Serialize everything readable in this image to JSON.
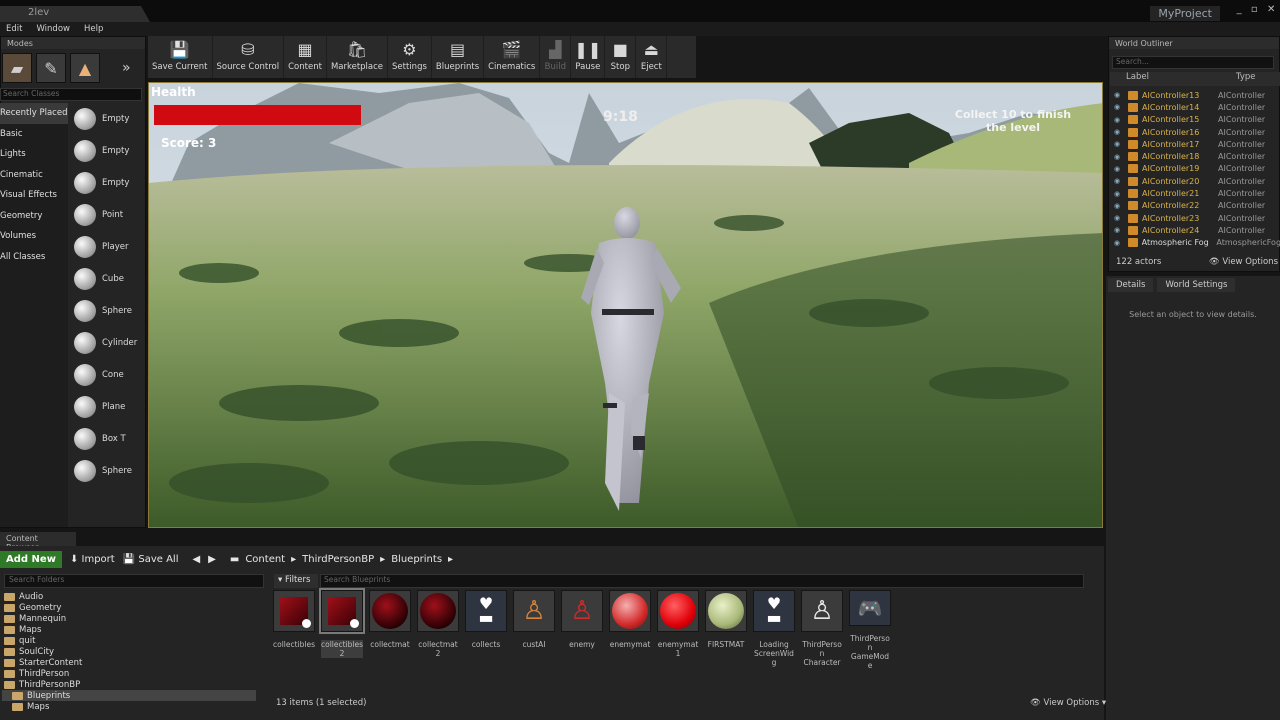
{
  "window": {
    "doc_tab": "2lev",
    "project": "MyProject",
    "controls": [
      "_",
      "▫",
      "✕"
    ]
  },
  "menu": [
    "Edit",
    "Window",
    "Help"
  ],
  "modes": {
    "title": "Modes",
    "search_placeholder": "Search Classes",
    "categories": [
      "Recently Placed",
      "Basic",
      "Lights",
      "Cinematic",
      "Visual Effects",
      "Geometry",
      "Volumes",
      "All Classes"
    ],
    "placeables": [
      "Empty",
      "Empty",
      "Empty",
      "Point",
      "Player",
      "Cube",
      "Sphere",
      "Cylinder",
      "Cone",
      "Plane",
      "Box T",
      "Sphere"
    ]
  },
  "toolbar": [
    {
      "label": "Save Current",
      "icon": "save-icon"
    },
    {
      "label": "Source Control",
      "icon": "source-control-icon"
    },
    {
      "label": "Content",
      "icon": "content-icon"
    },
    {
      "label": "Marketplace",
      "icon": "marketplace-icon"
    },
    {
      "label": "Settings",
      "icon": "settings-icon"
    },
    {
      "label": "Blueprints",
      "icon": "blueprints-icon"
    },
    {
      "label": "Cinematics",
      "icon": "cinematics-icon"
    },
    {
      "label": "Build",
      "icon": "build-icon"
    },
    {
      "label": "Pause",
      "icon": "pause-icon"
    },
    {
      "label": "Stop",
      "icon": "stop-icon"
    },
    {
      "label": "Eject",
      "icon": "eject-icon"
    }
  ],
  "hud": {
    "health_label": "Health",
    "health_fraction": 1.0,
    "score": "Score:  3",
    "timer": "9:18",
    "goal": "Collect 10 to finish the level"
  },
  "outliner": {
    "title": "World Outliner",
    "search_placeholder": "Search...",
    "col_label": "Label",
    "col_type": "Type",
    "rows": [
      {
        "label": "AIController13",
        "type": "AIController"
      },
      {
        "label": "AIController14",
        "type": "AIController"
      },
      {
        "label": "AIController15",
        "type": "AIController"
      },
      {
        "label": "AIController16",
        "type": "AIController"
      },
      {
        "label": "AIController17",
        "type": "AIController"
      },
      {
        "label": "AIController18",
        "type": "AIController"
      },
      {
        "label": "AIController19",
        "type": "AIController"
      },
      {
        "label": "AIController20",
        "type": "AIController"
      },
      {
        "label": "AIController21",
        "type": "AIController"
      },
      {
        "label": "AIController22",
        "type": "AIController"
      },
      {
        "label": "AIController23",
        "type": "AIController"
      },
      {
        "label": "AIController24",
        "type": "AIController"
      },
      {
        "label": "Atmospheric Fog",
        "type": "AtmosphericFog"
      }
    ],
    "actor_count": "122 actors",
    "view_options": "View Options"
  },
  "details": {
    "tab_details": "Details",
    "tab_world": "World Settings",
    "empty_msg": "Select an object to view details."
  },
  "content_browser": {
    "tab": "Content Browser",
    "add_new": "Add New",
    "import": "Import",
    "save_all": "Save All",
    "breadcrumb": [
      "Content",
      "ThirdPersonBP",
      "Blueprints"
    ],
    "folder_search": "Search Folders",
    "filters": "Filters",
    "asset_search": "Search Blueprints",
    "folders": [
      {
        "name": "Audio",
        "depth": 0
      },
      {
        "name": "Geometry",
        "depth": 0
      },
      {
        "name": "Mannequin",
        "depth": 0
      },
      {
        "name": "Maps",
        "depth": 0
      },
      {
        "name": "quit",
        "depth": 0
      },
      {
        "name": "SoulCity",
        "depth": 0
      },
      {
        "name": "StarterContent",
        "depth": 0
      },
      {
        "name": "ThirdPerson",
        "depth": 0
      },
      {
        "name": "ThirdPersonBP",
        "depth": 0
      },
      {
        "name": "Blueprints",
        "depth": 1,
        "selected": true
      },
      {
        "name": "Maps",
        "depth": 1
      }
    ],
    "assets": [
      {
        "name": "collectibles",
        "kind": "cube"
      },
      {
        "name": "collectibles2",
        "kind": "cube",
        "selected": true
      },
      {
        "name": "collectmat",
        "kind": "darkred"
      },
      {
        "name": "collectmat2",
        "kind": "darkred"
      },
      {
        "name": "collects",
        "kind": "widget"
      },
      {
        "name": "custAI",
        "kind": "char-orange"
      },
      {
        "name": "enemy",
        "kind": "char-red"
      },
      {
        "name": "enemymat",
        "kind": "pink"
      },
      {
        "name": "enemymat1",
        "kind": "red"
      },
      {
        "name": "FIRSTMAT",
        "kind": "green"
      },
      {
        "name": "Loading ScreenWidg",
        "kind": "widget"
      },
      {
        "name": "ThirdPerson Character",
        "kind": "char-white"
      },
      {
        "name": "ThirdPerson GameMode",
        "kind": "gamepad"
      }
    ],
    "item_count": "13 items (1 selected)",
    "view_options": "View Options"
  }
}
